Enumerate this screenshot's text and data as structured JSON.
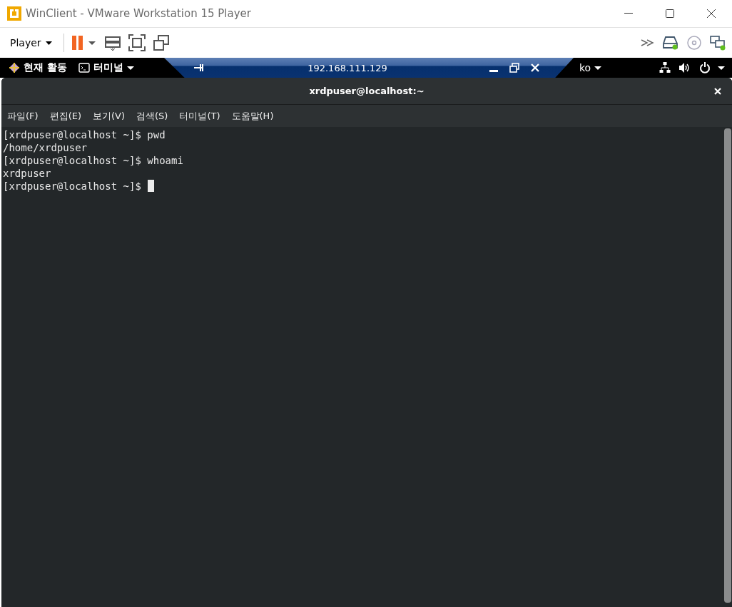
{
  "window": {
    "title": "WinClient - VMware Workstation 15 Player"
  },
  "toolbar": {
    "player_menu": "Player"
  },
  "top_bar": {
    "activities": "현재 활동",
    "app_menu": "터미널",
    "keyboard": "ko"
  },
  "remote_bar": {
    "host": "192.168.111.129"
  },
  "terminal": {
    "title": "xrdpuser@localhost:~",
    "menu": [
      "파일(F)",
      "편집(E)",
      "보기(V)",
      "검색(S)",
      "터미널(T)",
      "도움말(H)"
    ],
    "lines": [
      {
        "kind": "command",
        "prompt": "[xrdpuser@localhost ~]$",
        "command": "pwd"
      },
      {
        "kind": "output",
        "text": "/home/xrdpuser"
      },
      {
        "kind": "command",
        "prompt": "[xrdpuser@localhost ~]$",
        "command": "whoami"
      },
      {
        "kind": "output",
        "text": "xrdpuser"
      },
      {
        "kind": "prompt",
        "prompt": "[xrdpuser@localhost ~]$"
      }
    ]
  }
}
